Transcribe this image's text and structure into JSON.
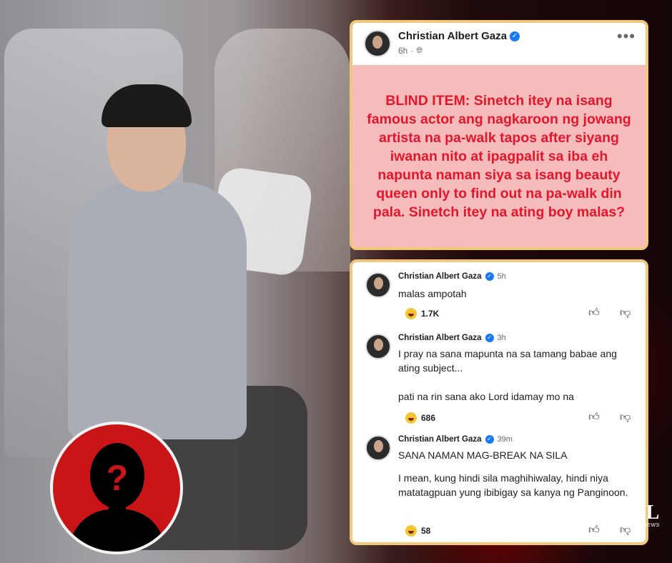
{
  "post": {
    "author": "Christian Albert Gaza",
    "time": "6h",
    "more": "•••",
    "text": "BLIND ITEM: Sinetch itey na isang famous actor ang nagkaroon ng jowang artista na pa-walk tapos after siyang iwanan nito at ipagpalit sa iba eh napunta naman siya sa isang beauty queen only to find out na pa-walk din pala. Sinetch itey na ating boy malas?"
  },
  "comments": [
    {
      "author": "Christian Albert Gaza",
      "time": "5h",
      "text_lines": [
        "malas ampotah"
      ],
      "reactions": "1.7K"
    },
    {
      "author": "Christian Albert Gaza",
      "time": "3h",
      "text_lines": [
        "I pray na sana mapunta na sa tamang babae ang ating subject...",
        "pati na rin sana ako Lord idamay mo na"
      ],
      "reactions": "686"
    },
    {
      "author": "Christian Albert Gaza",
      "time": "39m",
      "text_lines": [
        "SANA NAMAN MAG-BREAK NA SILA",
        "I mean, kung hindi sila maghihiwalay, hindi niya matatagpuan yung ibibigay sa kanya ng Panginoon."
      ],
      "reactions": "58"
    }
  ],
  "avatar_question": "?",
  "watermark": {
    "logo": "JL",
    "text": "JL NEWS"
  },
  "colors": {
    "post_text": "#e3162c",
    "post_bg": "#f6bcbc",
    "card_border": "#f2c77c",
    "avatar_red": "#c91517",
    "verified": "#1877f2"
  },
  "icons": [
    "verified-icon",
    "globe-icon",
    "more-icon",
    "haha-icon",
    "thumb-up-icon",
    "thumb-down-icon",
    "question-silhouette-icon"
  ]
}
